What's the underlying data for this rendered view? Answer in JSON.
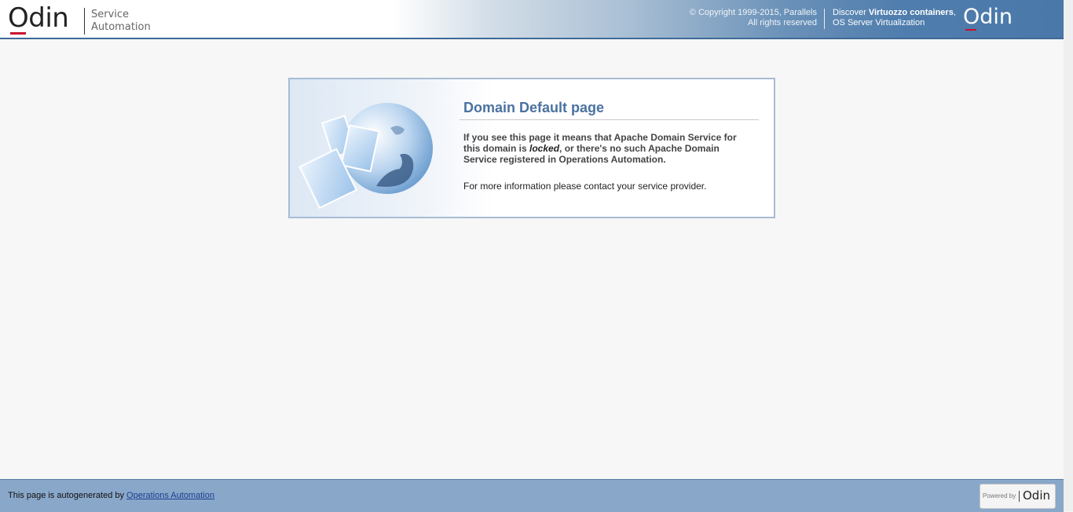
{
  "header": {
    "logo_word": "Odin",
    "logo_sub_line1": "Service",
    "logo_sub_line2": "Automation",
    "copyright_line1": "© Copyright 1999-2015, Parallels",
    "copyright_line2": "All rights reserved",
    "discover_prefix": "Discover ",
    "discover_bold": "Virtuozzo containers",
    "discover_suffix": ",",
    "discover_line2": "OS Server Virtualization",
    "right_logo": "Odin"
  },
  "card": {
    "title": "Domain Default page",
    "p1_before": "If you see this page it means that Apache Domain Service for this domain is ",
    "p1_italic": "locked",
    "p1_after": ", or there's no such Apache Domain Service registered in Operations Automation.",
    "p2": "For more information please contact your service provider."
  },
  "footer": {
    "text": "This page is autogenerated by ",
    "link": "Operations Automation",
    "powered_by": "Powered by",
    "powered_logo": "Odin"
  },
  "colors": {
    "accent_title": "#4a72a0",
    "header_blue": "#4a78a8",
    "footer_blue": "#89a7c9",
    "odin_red": "#c8102e"
  }
}
